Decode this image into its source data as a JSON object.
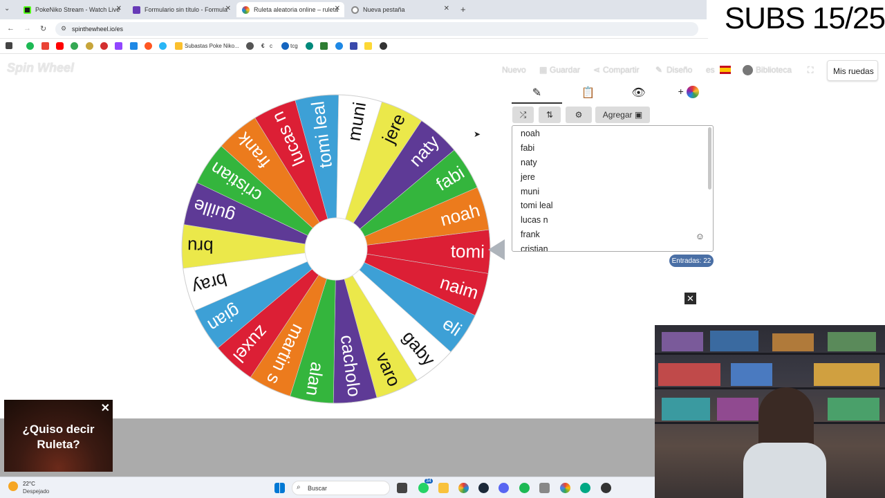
{
  "browser": {
    "tabs": [
      {
        "label": "PokeNiko Stream - Watch Live",
        "favicon_color": "#53fc18"
      },
      {
        "label": "Formulario sin título - Formula",
        "favicon_color": "#673ab7"
      },
      {
        "label": "Ruleta aleatoria online – ruleta",
        "favicon_color": "#e53935"
      },
      {
        "label": "Nueva pestaña",
        "favicon_color": "#888888"
      }
    ],
    "url": "spinthewheel.io/es",
    "bookmarks": [
      {
        "label": "Subastas Poke Niko..."
      },
      {
        "label": "c"
      },
      {
        "label": "tcg"
      }
    ]
  },
  "overlay": {
    "subs": "SUBS 15/25"
  },
  "app": {
    "logo": "Spin Wheel",
    "nav": {
      "nuevo": "Nuevo",
      "guardar": "Guardar",
      "compartir": "Compartir",
      "diseno": "Diseño",
      "lang": "es",
      "biblioteca": "Biblioteca",
      "mis_ruedas": "Mis ruedas"
    },
    "toolbar": {
      "agregar": "Agregar"
    },
    "entries": [
      "noah",
      "fabi",
      "naty",
      "jere",
      "muni",
      "tomi leal",
      "lucas n",
      "frank",
      "cristian"
    ],
    "entries_count": "Entradas: 22"
  },
  "wheel": {
    "segments": [
      {
        "label": "tomi",
        "color": "#dc1f35"
      },
      {
        "label": "naim",
        "color": "#dc1f35"
      },
      {
        "label": "eli",
        "color": "#3da0d6"
      },
      {
        "label": "gaby",
        "color": "#ffffff"
      },
      {
        "label": "varo",
        "color": "#ebe84a"
      },
      {
        "label": "cacholo",
        "color": "#5e3a96"
      },
      {
        "label": "alan",
        "color": "#34b53d"
      },
      {
        "label": "martin s",
        "color": "#ec7b1d"
      },
      {
        "label": "zuxel",
        "color": "#dc1f35"
      },
      {
        "label": "gian",
        "color": "#3da0d6"
      },
      {
        "label": "bray",
        "color": "#ffffff"
      },
      {
        "label": "bru",
        "color": "#ebe84a"
      },
      {
        "label": "guille",
        "color": "#5e3a96"
      },
      {
        "label": "cristian",
        "color": "#34b53d"
      },
      {
        "label": "frank",
        "color": "#ec7b1d"
      },
      {
        "label": "lucas n",
        "color": "#dc1f35"
      },
      {
        "label": "tomi leal",
        "color": "#3da0d6"
      },
      {
        "label": "muni",
        "color": "#ffffff"
      },
      {
        "label": "jere",
        "color": "#ebe84a"
      },
      {
        "label": "naty",
        "color": "#5e3a96"
      },
      {
        "label": "fabi",
        "color": "#34b53d"
      },
      {
        "label": "noah",
        "color": "#ec7b1d"
      }
    ]
  },
  "ad": {
    "text": "¿Quiso decir Ruleta?"
  },
  "taskbar": {
    "temp": "22°C",
    "weather": "Despejado",
    "search": "Buscar",
    "badge": "34"
  }
}
